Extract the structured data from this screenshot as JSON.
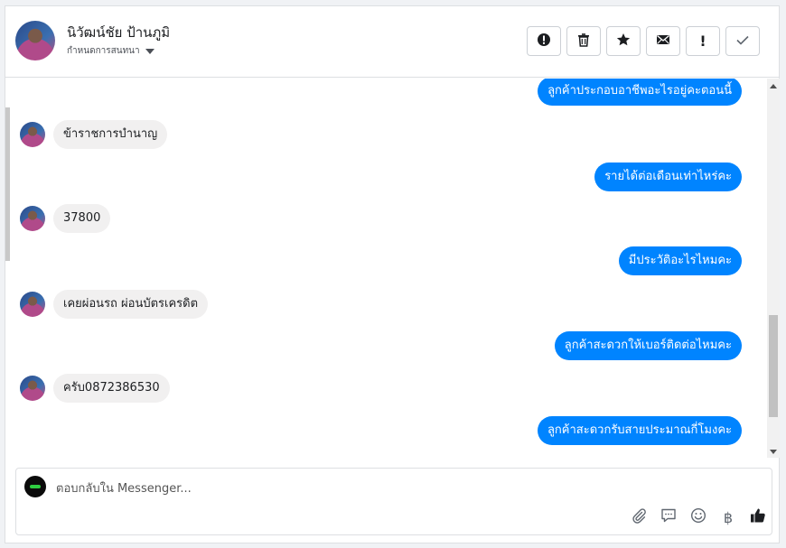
{
  "header": {
    "contact_name": "นิวัฒน์ชัย ป้านภูมิ",
    "assign_label": "กำหนดการสนทนา",
    "actions": [
      {
        "name": "report-button",
        "icon": "alert-circle-icon"
      },
      {
        "name": "delete-button",
        "icon": "trash-icon"
      },
      {
        "name": "star-button",
        "icon": "star-icon"
      },
      {
        "name": "mark-unread-button",
        "icon": "envelope-icon"
      },
      {
        "name": "mark-important-button",
        "icon": "exclamation-icon"
      },
      {
        "name": "mark-done-button",
        "icon": "check-icon"
      }
    ]
  },
  "messages": [
    {
      "direction": "out",
      "text": "ลูกค้าประกอบอาชีพอะไรอยู่คะตอนนี้"
    },
    {
      "direction": "in",
      "text": "ข้าราชการบำนาญ"
    },
    {
      "direction": "out",
      "text": "รายได้ต่อเดือนเท่าไหร่คะ"
    },
    {
      "direction": "in",
      "text": "37800"
    },
    {
      "direction": "out",
      "text": "มีประวัติอะไรไหมคะ"
    },
    {
      "direction": "in",
      "text": "เคยผ่อนรถ ผ่อนบัตรเครดิต"
    },
    {
      "direction": "out",
      "text": "ลูกค้าสะดวกให้เบอร์ติดต่อไหมคะ"
    },
    {
      "direction": "in",
      "text": "ครับ0872386530"
    },
    {
      "direction": "out",
      "text": "ลูกค้าสะดวกรับสายประมาณกี่โมงคะ"
    }
  ],
  "composer": {
    "placeholder": "ตอบกลับใน Messenger...",
    "tools": [
      "paperclip-icon",
      "saved-reply-icon",
      "emoji-icon",
      "baht-icon",
      "thumbs-up-icon"
    ],
    "baht_symbol": "฿"
  },
  "colors": {
    "outgoing_bubble": "#0084ff",
    "incoming_bubble": "#f1f0f0"
  }
}
